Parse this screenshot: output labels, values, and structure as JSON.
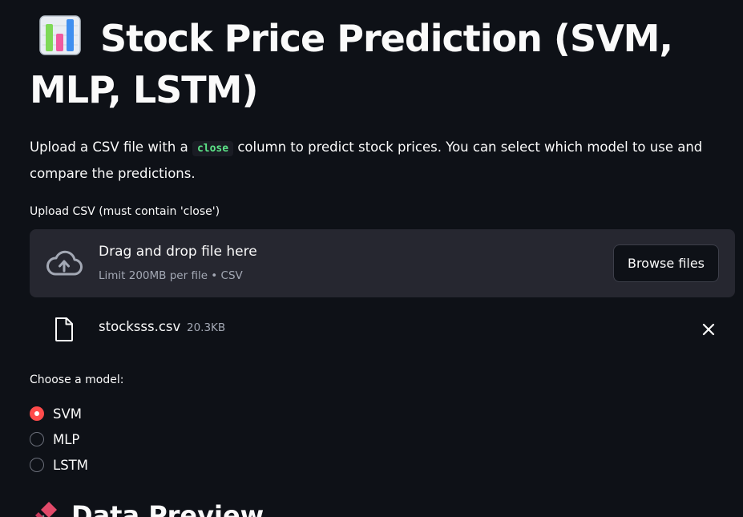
{
  "header": {
    "title": "Stock Price Prediction (SVM, MLP, LSTM)",
    "title_icon": "bar-chart-icon"
  },
  "description": {
    "before": "Upload a CSV file with a ",
    "code": "close",
    "after": " column to predict stock prices. You can select which model to use and compare the predictions."
  },
  "uploader": {
    "label": "Upload CSV (must contain 'close')",
    "drop_title": "Drag and drop file here",
    "drop_subtitle": "Limit 200MB per file • CSV",
    "browse_label": "Browse files",
    "icon": "cloud-upload-icon"
  },
  "uploaded_file": {
    "name": "stocksss.csv",
    "size": "20.3KB",
    "icon": "file-icon",
    "remove_icon": "close-icon"
  },
  "model_select": {
    "label": "Choose a model:",
    "options": [
      "SVM",
      "MLP",
      "LSTM"
    ],
    "selected": "SVM"
  },
  "section": {
    "heading": "Data Preview",
    "icon": "pushpin-icon"
  },
  "colors": {
    "background": "#0e1117",
    "surface": "#262730",
    "accent": "#ff4b4b",
    "code_text": "#5ce488",
    "muted_text": "#a3a8b4"
  }
}
